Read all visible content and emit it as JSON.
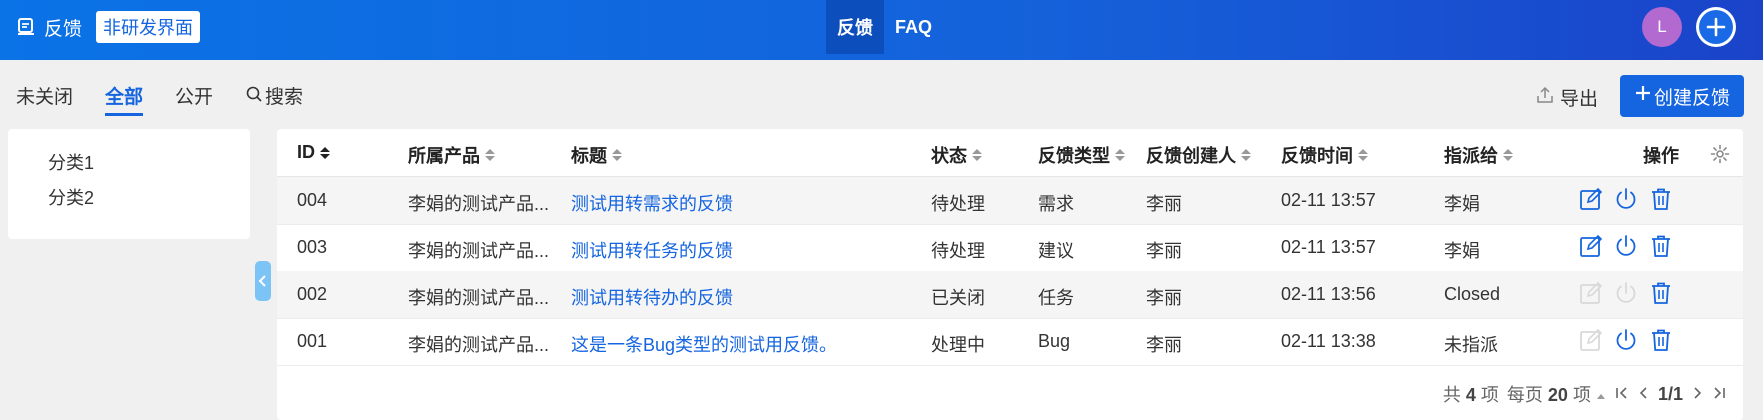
{
  "header": {
    "app_title": "反馈",
    "mode_badge": "非研发界面",
    "nav": [
      {
        "label": "反馈",
        "active": true
      },
      {
        "label": "FAQ",
        "active": false
      }
    ],
    "avatar_initial": "L"
  },
  "subbar": {
    "tabs": [
      {
        "label": "未关闭",
        "active": false
      },
      {
        "label": "全部",
        "active": true
      },
      {
        "label": "公开",
        "active": false
      },
      {
        "label": "搜索",
        "active": false
      }
    ],
    "export_label": "导出",
    "create_label": "创建反馈"
  },
  "sidebar": {
    "categories": [
      "分类1",
      "分类2"
    ]
  },
  "table": {
    "columns": [
      "ID",
      "所属产品",
      "标题",
      "状态",
      "反馈类型",
      "反馈创建人",
      "反馈时间",
      "指派给",
      "操作"
    ],
    "rows": [
      {
        "id": "004",
        "product": "李娟的测试产品...",
        "title": "测试用转需求的反馈",
        "status": "待处理",
        "type": "需求",
        "creator": "李丽",
        "time": "02-11 13:57",
        "assignee": "李娟",
        "edit_enabled": true
      },
      {
        "id": "003",
        "product": "李娟的测试产品...",
        "title": "测试用转任务的反馈",
        "status": "待处理",
        "type": "建议",
        "creator": "李丽",
        "time": "02-11 13:57",
        "assignee": "李娟",
        "edit_enabled": true
      },
      {
        "id": "002",
        "product": "李娟的测试产品...",
        "title": "测试用转待办的反馈",
        "status": "已关闭",
        "type": "任务",
        "creator": "李丽",
        "time": "02-11 13:56",
        "assignee": "Closed",
        "edit_enabled": false
      },
      {
        "id": "001",
        "product": "李娟的测试产品...",
        "title": "这是一条Bug类型的测试用反馈。",
        "status": "处理中",
        "type": "Bug",
        "creator": "李丽",
        "time": "02-11 13:38",
        "assignee": "未指派",
        "edit_enabled": false
      }
    ]
  },
  "pagination": {
    "total_prefix": "共",
    "total": "4",
    "total_suffix": "项",
    "per_page_prefix": "每页",
    "per_page": "20",
    "per_page_suffix": "项",
    "page_indicator": "1/1"
  },
  "colors": {
    "accent": "#1565e0",
    "avatar": "#b26ad0",
    "disabled_icon": "#d9d9d9"
  }
}
